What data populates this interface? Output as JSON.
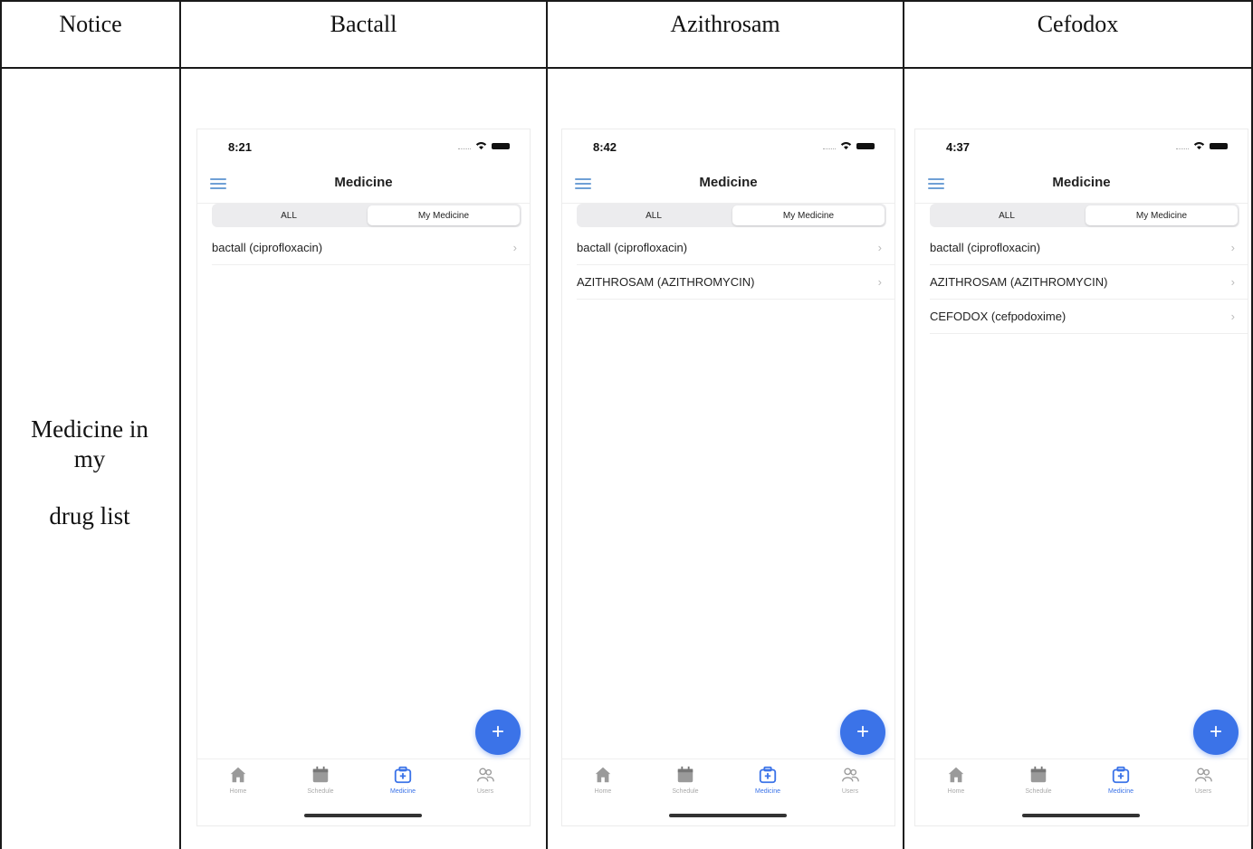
{
  "table": {
    "headers": [
      "Notice",
      "Bactall",
      "Azithrosam",
      "Cefodox"
    ],
    "row_label": [
      "Medicine in",
      "my",
      "drug list"
    ]
  },
  "phones": [
    {
      "time": "8:21",
      "title": "Medicine",
      "segment_all": "ALL",
      "segment_my": "My Medicine",
      "items": [
        "bactall (ciprofloxacin)"
      ],
      "fab": "+",
      "tabs": [
        "Home",
        "Schedule",
        "Medicine",
        "Users"
      ]
    },
    {
      "time": "8:42",
      "title": "Medicine",
      "segment_all": "ALL",
      "segment_my": "My Medicine",
      "items": [
        "bactall (ciprofloxacin)",
        "AZITHROSAM (AZITHROMYCIN)"
      ],
      "fab": "+",
      "tabs": [
        "Home",
        "Schedule",
        "Medicine",
        "Users"
      ]
    },
    {
      "time": "4:37",
      "title": "Medicine",
      "segment_all": "ALL",
      "segment_my": "My Medicine",
      "items": [
        "bactall (ciprofloxacin)",
        "AZITHROSAM (AZITHROMYCIN)",
        "CEFODOX (cefpodoxime)"
      ],
      "fab": "+",
      "tabs": [
        "Home",
        "Schedule",
        "Medicine",
        "Users"
      ]
    }
  ],
  "colors": {
    "accent": "#3b73e8",
    "menu": "#6fa0d6"
  }
}
